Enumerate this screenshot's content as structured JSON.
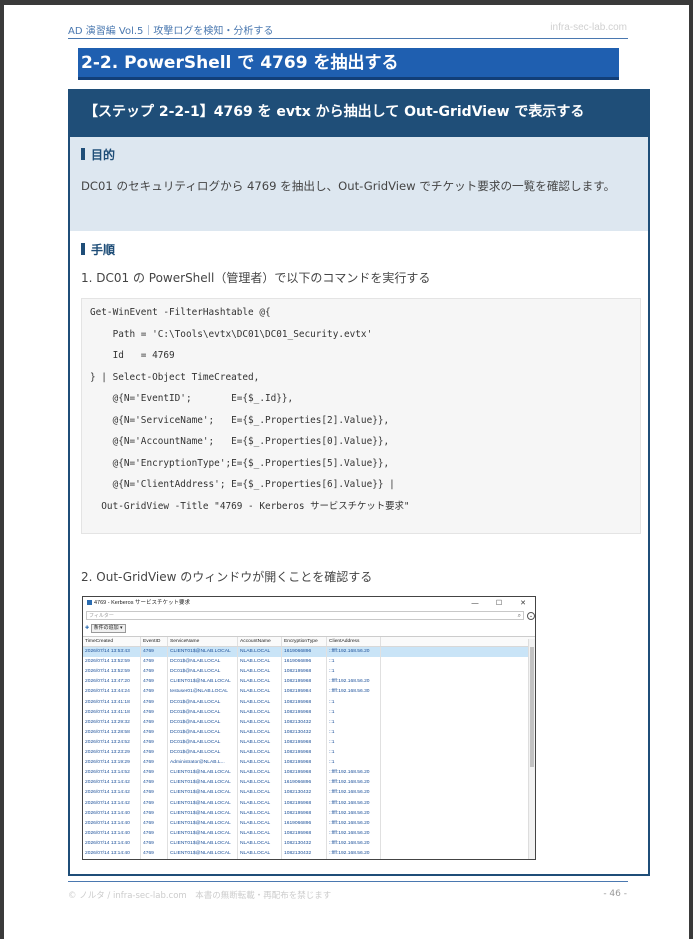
{
  "header": {
    "left": "AD 演習編 Vol.5｜攻撃ログを検知・分析する",
    "right": "infra-sec-lab.com"
  },
  "section_title": "2-2. PowerShell で 4769 を抽出する",
  "step_box": {
    "title": "【ステップ 2-2-1】4769 を evtx から抽出して Out-GridView で表示する",
    "purpose_label": "目的",
    "purpose_text": "DC01 のセキュリティログから 4769 を抽出し、Out-GridView でチケット要求の一覧を確認します。",
    "procedure_label": "手順",
    "step1": "1.  DC01 の PowerShell（管理者）で以下のコマンドを実行する",
    "code_lines": [
      "Get-WinEvent -FilterHashtable @{",
      "    Path = 'C:\\Tools\\evtx\\DC01\\DC01_Security.evtx'",
      "    Id   = 4769",
      "} | Select-Object TimeCreated,",
      "    @{N='EventID';       E={$_.Id}},",
      "    @{N='ServiceName';   E={$_.Properties[2].Value}},",
      "    @{N='AccountName';   E={$_.Properties[0].Value}},",
      "    @{N='EncryptionType';E={$_.Properties[5].Value}},",
      "    @{N='ClientAddress'; E={$_.Properties[6].Value}} |",
      "  Out-GridView -Title \"4769 - Kerberos サービスチケット要求\""
    ],
    "step2": "2.  Out-GridView のウィンドウが開くことを確認する"
  },
  "gridview": {
    "title": "4769 - Kerberos サービスチケット要求",
    "controls": [
      "—",
      "☐",
      "✕"
    ],
    "filter_placeholder": "フィルター",
    "add_condition": "条件の追加",
    "columns": [
      "TimeCreated",
      "EventID",
      "ServiceName",
      "AccountName",
      "EncryptionType",
      "ClientAddress"
    ],
    "rows": [
      [
        "2026/07/14 13:53:43",
        "4769",
        "CLIENT01$@NLAB.LOCAL",
        "NLAB.LOCAL",
        "1619066896",
        "::ffff:192.168.56.20"
      ],
      [
        "2026/07/14 13:52:59",
        "4769",
        "DC01$@NLAB.LOCAL",
        "NLAB.LOCAL",
        "1619066896",
        "::1"
      ],
      [
        "2026/07/14 13:52:59",
        "4769",
        "DC01$@NLAB.LOCAL",
        "NLAB.LOCAL",
        "1082195968",
        "::1"
      ],
      [
        "2026/07/14 13:47:20",
        "4769",
        "CLIENT01$@NLAB.LOCAL",
        "NLAB.LOCAL",
        "1082195968",
        "::ffff:192.168.56.20"
      ],
      [
        "2026/07/14 13:44:24",
        "4769",
        "testuser01@NLAB.LOCAL",
        "NLAB.LOCAL",
        "1082195984",
        "::ffff:192.168.56.30"
      ],
      [
        "2026/07/14 13:41:18",
        "4769",
        "DC01$@NLAB.LOCAL",
        "NLAB.LOCAL",
        "1082195968",
        "::1"
      ],
      [
        "2026/07/14 13:41:18",
        "4769",
        "DC01$@NLAB.LOCAL",
        "NLAB.LOCAL",
        "1082195968",
        "::1"
      ],
      [
        "2026/07/14 13:29:32",
        "4769",
        "DC01$@NLAB.LOCAL",
        "NLAB.LOCAL",
        "1082130432",
        "::1"
      ],
      [
        "2026/07/14 13:28:58",
        "4769",
        "DC01$@NLAB.LOCAL",
        "NLAB.LOCAL",
        "1082130432",
        "::1"
      ],
      [
        "2026/07/14 13:24:52",
        "4769",
        "DC01$@NLAB.LOCAL",
        "NLAB.LOCAL",
        "1082195968",
        "::1"
      ],
      [
        "2026/07/14 13:23:29",
        "4769",
        "DC01$@NLAB.LOCAL",
        "NLAB.LOCAL",
        "1082195968",
        "::1"
      ],
      [
        "2026/07/14 13:19:29",
        "4769",
        "Administrator@NLAB.L...",
        "NLAB.LOCAL",
        "1082195968",
        "::1"
      ],
      [
        "2026/07/14 13:14:52",
        "4769",
        "CLIENT01$@NLAB.LOCAL",
        "NLAB.LOCAL",
        "1082195968",
        "::ffff:192.168.56.20"
      ],
      [
        "2026/07/14 13:14:42",
        "4769",
        "CLIENT01$@NLAB.LOCAL",
        "NLAB.LOCAL",
        "1619066896",
        "::ffff:192.168.56.20"
      ],
      [
        "2026/07/14 13:14:42",
        "4769",
        "CLIENT01$@NLAB.LOCAL",
        "NLAB.LOCAL",
        "1082130432",
        "::ffff:192.168.56.20"
      ],
      [
        "2026/07/14 13:14:42",
        "4769",
        "CLIENT01$@NLAB.LOCAL",
        "NLAB.LOCAL",
        "1082195968",
        "::ffff:192.168.56.20"
      ],
      [
        "2026/07/14 13:14:40",
        "4769",
        "CLIENT01$@NLAB.LOCAL",
        "NLAB.LOCAL",
        "1082195968",
        "::ffff:192.168.56.20"
      ],
      [
        "2026/07/14 13:14:40",
        "4769",
        "CLIENT01$@NLAB.LOCAL",
        "NLAB.LOCAL",
        "1619066896",
        "::ffff:192.168.56.20"
      ],
      [
        "2026/07/14 13:14:40",
        "4769",
        "CLIENT01$@NLAB.LOCAL",
        "NLAB.LOCAL",
        "1082195968",
        "::ffff:192.168.56.20"
      ],
      [
        "2026/07/14 13:14:40",
        "4769",
        "CLIENT01$@NLAB.LOCAL",
        "NLAB.LOCAL",
        "1082130432",
        "::ffff:192.168.56.20"
      ],
      [
        "2026/07/14 13:14:40",
        "4769",
        "CLIENT01$@NLAB.LOCAL",
        "NLAB.LOCAL",
        "1082130432",
        "::ffff:192.168.56.20"
      ]
    ]
  },
  "footer": {
    "left": "© ノルタ / infra-sec-lab.com　本書の無断転載・再配布を禁じます",
    "right": "- 46 -"
  },
  "colors": {
    "accent_blue": "#1f5fb0",
    "box_navy": "#1f4e78",
    "purpose_bg": "#dde7f0",
    "link_blue": "#1a4f99"
  }
}
